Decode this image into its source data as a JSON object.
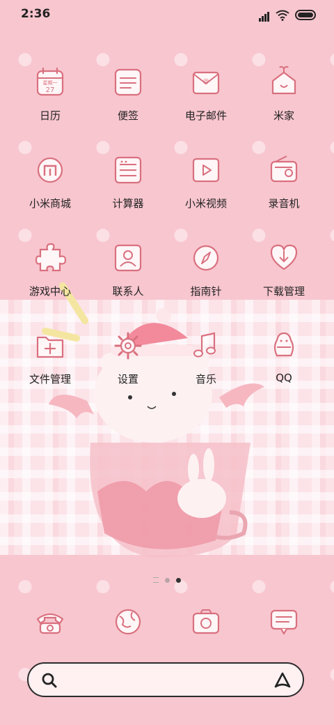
{
  "status_bar": {
    "time": "2:36"
  },
  "apps": [
    {
      "label": "日历",
      "icon": "calendar-icon",
      "icon_text_top": "星期一",
      "icon_text_num": "27"
    },
    {
      "label": "便签",
      "icon": "notes-icon"
    },
    {
      "label": "电子邮件",
      "icon": "mail-icon"
    },
    {
      "label": "米家",
      "icon": "home-icon"
    },
    {
      "label": "小米商城",
      "icon": "mi-store-icon"
    },
    {
      "label": "计算器",
      "icon": "calculator-icon"
    },
    {
      "label": "小米视频",
      "icon": "video-icon"
    },
    {
      "label": "录音机",
      "icon": "recorder-icon"
    },
    {
      "label": "游戏中心",
      "icon": "puzzle-icon"
    },
    {
      "label": "联系人",
      "icon": "contacts-icon"
    },
    {
      "label": "指南针",
      "icon": "compass-icon"
    },
    {
      "label": "下载管理",
      "icon": "download-heart-icon"
    },
    {
      "label": "文件管理",
      "icon": "folder-icon"
    },
    {
      "label": "设置",
      "icon": "gear-icon"
    },
    {
      "label": "音乐",
      "icon": "music-icon"
    },
    {
      "label": "QQ",
      "icon": "qq-icon"
    }
  ],
  "dock": [
    {
      "icon": "phone-icon"
    },
    {
      "icon": "browser-globe-icon"
    },
    {
      "icon": "camera-icon"
    },
    {
      "icon": "messages-icon"
    }
  ],
  "page_indicator": {
    "pages": 2,
    "active": 2
  },
  "colors": {
    "background": "#f8c6cf",
    "icon_stroke": "#d9707f",
    "text": "#222222"
  }
}
